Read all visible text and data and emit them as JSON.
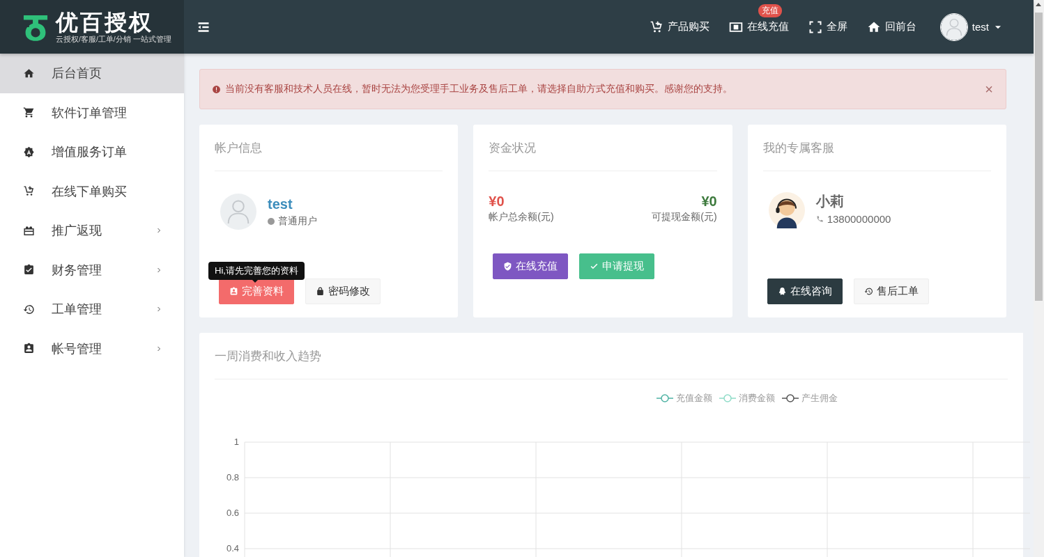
{
  "header": {
    "logo": {
      "title": "优百授权",
      "subtitle": "云授权/客服/工单/分销 一站式管理"
    },
    "nav": [
      {
        "label": "产品购买"
      },
      {
        "label": "在线充值",
        "badge": "充值"
      },
      {
        "label": "全屏"
      },
      {
        "label": "回前台"
      }
    ],
    "user": {
      "name": "test"
    }
  },
  "sidebar": {
    "items": [
      {
        "label": "后台首页",
        "selected": true,
        "kind": "link"
      },
      {
        "label": "软件订单管理",
        "selected": false,
        "kind": "link"
      },
      {
        "label": "增值服务订单",
        "selected": false,
        "kind": "link"
      },
      {
        "label": "在线下单购买",
        "selected": false,
        "kind": "link"
      },
      {
        "label": "推广返现",
        "selected": false,
        "kind": "submenu"
      },
      {
        "label": "财务管理",
        "selected": false,
        "kind": "submenu"
      },
      {
        "label": "工单管理",
        "selected": false,
        "kind": "submenu"
      },
      {
        "label": "帐号管理",
        "selected": false,
        "kind": "submenu"
      }
    ]
  },
  "alert": {
    "text": "当前没有客服和技术人员在线，暂时无法为您受理手工业务及售后工单，请选择自助方式充值和购买。感谢您的支持。",
    "close": "×"
  },
  "account_card": {
    "title": "帐户信息",
    "name": "test",
    "role": "普通用户",
    "tooltip": "Hi,请先完善您的资料",
    "buttons": [
      {
        "label": "完善资料",
        "kind": "danger"
      },
      {
        "label": "密码修改",
        "kind": "default"
      }
    ]
  },
  "funds_card": {
    "title": "资金状况",
    "balances": [
      {
        "amount": "¥0",
        "label": "帐户总余额(元)",
        "kind": "total"
      },
      {
        "amount": "¥0",
        "label": "可提现金额(元)",
        "kind": "withdrawable"
      }
    ],
    "buttons": [
      {
        "label": "在线充值",
        "kind": "purple"
      },
      {
        "label": "申请提现",
        "kind": "success"
      }
    ]
  },
  "service_card": {
    "title": "我的专属客服",
    "name": "小莉",
    "phone": "13800000000",
    "buttons": [
      {
        "label": "在线咨询",
        "kind": "dark"
      },
      {
        "label": "售后工单",
        "kind": "default"
      }
    ]
  },
  "trend_card": {
    "title": "一周消费和收入趋势",
    "chart_data": {
      "type": "line",
      "grid": true,
      "ylim": [
        0.35,
        1
      ],
      "yticks": [
        0.4,
        0.6,
        0.8,
        1
      ],
      "series": [
        {
          "name": "充值金额",
          "color": "#4fb3a4"
        },
        {
          "name": "消费金额",
          "color": "#8fdcc8"
        },
        {
          "name": "产生佣金",
          "color": "#555555"
        }
      ]
    }
  }
}
